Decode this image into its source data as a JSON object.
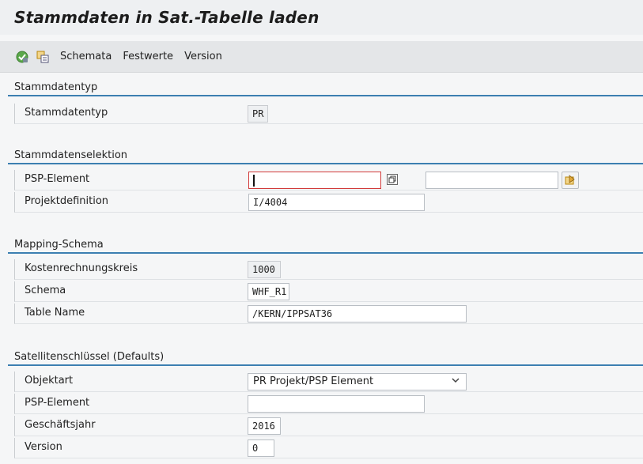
{
  "window": {
    "title": "Stammdaten in Sat.-Tabelle laden"
  },
  "toolbar": {
    "icons": [
      "execute-icon",
      "copy-variant-icon"
    ],
    "buttons": [
      "Schemata",
      "Festwerte",
      "Version"
    ]
  },
  "sections": {
    "stammdatentyp": {
      "header": "Stammdatentyp",
      "rows": [
        {
          "label": "Stammdatentyp",
          "value": "PR"
        }
      ]
    },
    "selektion": {
      "header": "Stammdatenselektion",
      "rows": [
        {
          "label": "PSP-Element",
          "value": "",
          "to_value": ""
        },
        {
          "label": "Projektdefinition",
          "value": "I/4004"
        }
      ]
    },
    "mapping": {
      "header": "Mapping-Schema",
      "rows": [
        {
          "label": "Kostenrechnungskreis",
          "value": "1000"
        },
        {
          "label": "Schema",
          "value": "WHF_R1"
        },
        {
          "label": "Table Name",
          "value": "/KERN/IPPSAT36"
        }
      ]
    },
    "satellit": {
      "header": "Satellitenschlüssel (Defaults)",
      "rows": [
        {
          "label": "Objektart",
          "value": "PR Projekt/PSP Element"
        },
        {
          "label": "PSP-Element",
          "value": ""
        },
        {
          "label": "Geschäftsjahr",
          "value": "2016"
        },
        {
          "label": "Version",
          "value": "0"
        }
      ]
    }
  },
  "colors": {
    "accent": "#3c7fb1",
    "focus": "#d23a3a",
    "background": "#f5f6f7"
  }
}
